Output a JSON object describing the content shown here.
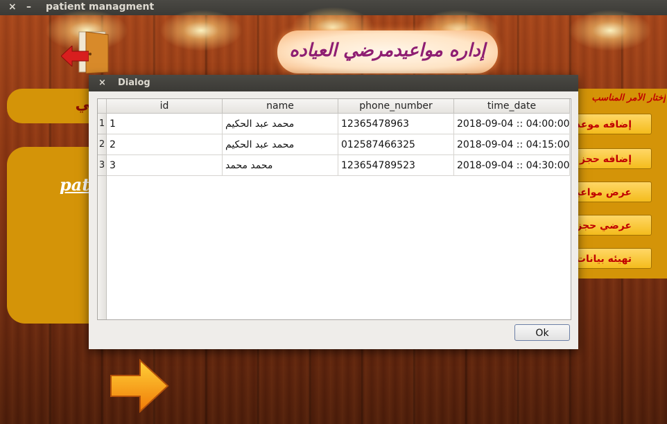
{
  "window": {
    "title": "patient managment",
    "close_glyph": "×",
    "minimize_glyph": "–"
  },
  "header": {
    "title": "إداره مواعيدمرضي العياده"
  },
  "left": {
    "bar_label": "التالي",
    "panel_text": "pat"
  },
  "right": {
    "heading": "إختار الأمر المناسب",
    "buttons": [
      "إضافه موعد",
      "إضافه حجز",
      "عرض مواعيد",
      "عرضي حجز",
      "تهيئه بيانات"
    ]
  },
  "dialog": {
    "title": "Dialog",
    "close_glyph": "×",
    "ok_label": "Ok",
    "columns": [
      "id",
      "name",
      "phone_number",
      "time_date"
    ],
    "rows": [
      {
        "num": "1",
        "id": "1",
        "name": "محمد عبد الحكيم",
        "phone": "12365478963",
        "time": "2018-09-04 :: 04:00:00"
      },
      {
        "num": "2",
        "id": "2",
        "name": "محمد عبد الحكيم",
        "phone": "012587466325",
        "time": "2018-09-04 :: 04:15:00"
      },
      {
        "num": "3",
        "id": "3",
        "name": "محمد محمد",
        "phone": "123654789523",
        "time": "2018-09-04 :: 04:30:00"
      }
    ]
  },
  "colors": {
    "accent_gold": "#d49408",
    "title_text": "#8e1e72",
    "button_text": "#c00000"
  },
  "icons": [
    "close-icon",
    "minimize-icon",
    "door-icon",
    "back-arrow-icon",
    "next-arrow-icon"
  ]
}
